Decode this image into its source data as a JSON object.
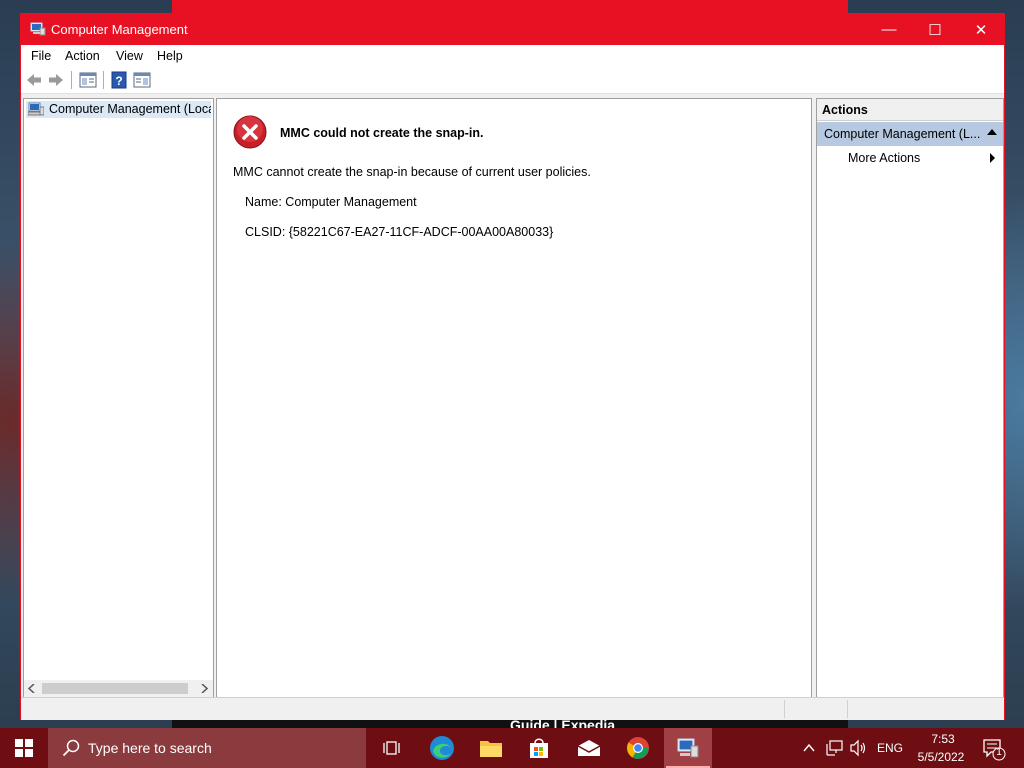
{
  "window": {
    "title": "Computer Management",
    "minimize_glyph": "—",
    "maximize_glyph": "☐",
    "close_glyph": "✕"
  },
  "menu": {
    "file": "File",
    "action": "Action",
    "view": "View",
    "help": "Help"
  },
  "tree": {
    "root_label": "Computer Management (Local"
  },
  "error": {
    "title": "MMC could not create the snap-in.",
    "message": "MMC cannot create the snap-in because of current user policies.",
    "name_line": "Name: Computer Management",
    "clsid_line": "CLSID: {58221C67-EA27-11CF-ADCF-00AA00A80033}"
  },
  "actions": {
    "header": "Actions",
    "section_title": "Computer Management (L...",
    "more_actions": "More Actions"
  },
  "desktop": {
    "background_text": "Guide | Expedia"
  },
  "taskbar": {
    "search_placeholder": "Type here to search",
    "language": "ENG",
    "time": "7:53",
    "date": "5/5/2022",
    "notification_count": "1"
  },
  "colors": {
    "accent": "#e81123",
    "taskbar": "#6e0d12",
    "selection": "#b6c9e0"
  }
}
